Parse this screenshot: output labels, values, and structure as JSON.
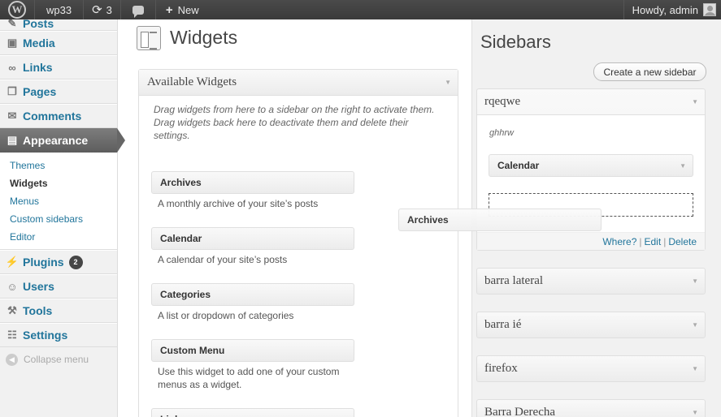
{
  "adminbar": {
    "site_name": "wp33",
    "updates_count": "3",
    "new_label": "New",
    "howdy": "Howdy, admin"
  },
  "menu": {
    "posts": "Posts",
    "media": "Media",
    "links": "Links",
    "pages": "Pages",
    "comments": "Comments",
    "appearance": "Appearance",
    "submenu": [
      "Themes",
      "Widgets",
      "Menus",
      "Custom sidebars",
      "Editor"
    ],
    "plugins": "Plugins",
    "plugins_badge": "2",
    "users": "Users",
    "tools": "Tools",
    "settings": "Settings",
    "collapse": "Collapse menu"
  },
  "main": {
    "title": "Widgets",
    "available_title": "Available Widgets",
    "available_desc": "Drag widgets from here to a sidebar on the right to activate them. Drag widgets back here to deactivate them and delete their settings.",
    "widgets": [
      {
        "title": "Archives",
        "desc": "A monthly archive of your site’s posts"
      },
      {
        "title": "Calendar",
        "desc": "A calendar of your site’s posts"
      },
      {
        "title": "Categories",
        "desc": "A list or dropdown of categories"
      },
      {
        "title": "Custom Menu",
        "desc": "Use this widget to add one of your custom menus as a widget."
      },
      {
        "title": "Links",
        "desc": ""
      }
    ]
  },
  "dragging": {
    "title": "Archives"
  },
  "sidebars": {
    "title": "Sidebars",
    "create_button": "Create a new sidebar",
    "open": {
      "name": "rqeqwe",
      "description": "ghhrw",
      "widget": "Calendar",
      "where": "Where?",
      "edit": "Edit",
      "delete": "Delete",
      "separator": "|"
    },
    "collapsed": [
      "barra lateral",
      "barra ié",
      "firefox",
      "Barra Derecha"
    ]
  },
  "colors": {
    "admin_bar": "#464646",
    "link": "#21759b",
    "current_menu": "#6d6d6d"
  }
}
